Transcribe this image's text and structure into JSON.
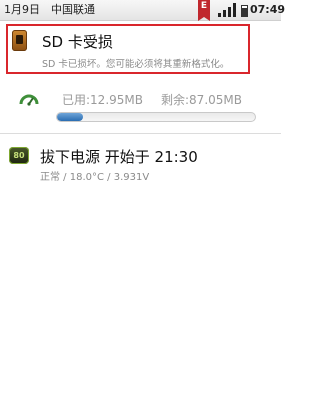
{
  "status_bar": {
    "date": "1月9日",
    "carrier": "中国联通",
    "ribbon_icon_label": "E",
    "time": "07:49"
  },
  "notifications": {
    "sd_card": {
      "title": "SD 卡受损",
      "description": "SD 卡已损坏。您可能必须将其重新格式化。"
    },
    "storage": {
      "used_text": "已用:12.95MB",
      "free_text": "剩余:87.05MB",
      "used_fraction": 0.13
    },
    "power": {
      "icon_label": "80",
      "title": "拔下电源 开始于 21:30",
      "subtitle": "正常 / 18.0°C / 3.931V"
    }
  },
  "colors": {
    "highlight_border": "#d9262c",
    "progress_fill": "#2a6db2",
    "gauge_green": "#3f8f3a"
  }
}
